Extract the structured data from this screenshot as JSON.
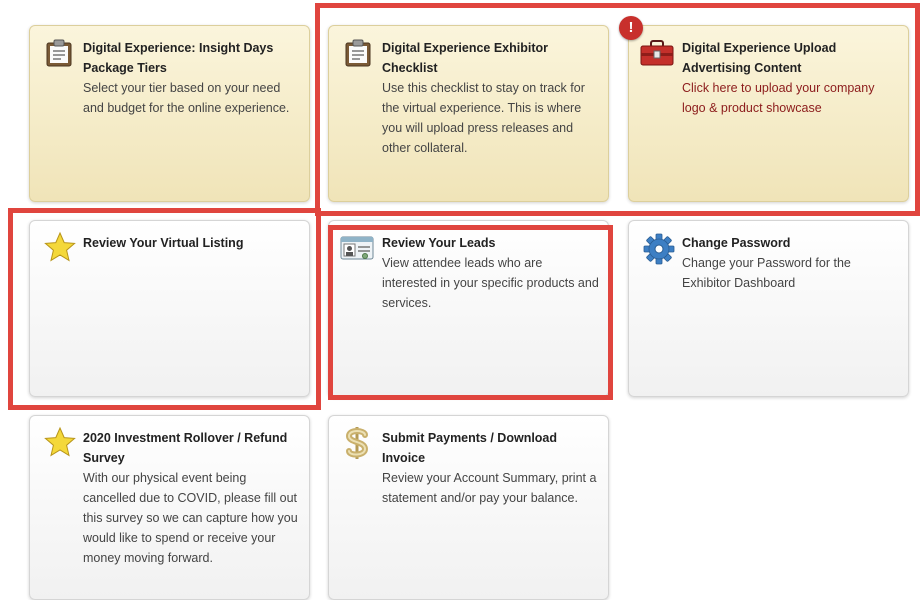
{
  "cards": [
    {
      "title": "Digital Experience: Insight Days Package Tiers",
      "desc": "Select your tier based on your need and budget for the online experience.",
      "icon": "clipboard-icon"
    },
    {
      "title": "Digital Experience Exhibitor Checklist",
      "desc": "Use this checklist to stay on track for the virtual experience. This is where you will upload press releases and other collateral.",
      "icon": "clipboard-icon"
    },
    {
      "title": "Digital Experience Upload Advertising Content",
      "desc": "Click here to upload your company logo & product showcase",
      "icon": "toolbox-icon",
      "badge": "!"
    },
    {
      "title": "Review Your Virtual Listing",
      "desc": "",
      "icon": "star-icon"
    },
    {
      "title": "Review Your Leads",
      "desc": "View attendee leads who are interested in your specific products and services.",
      "icon": "id-card-icon"
    },
    {
      "title": "Change Password",
      "desc": "Change your Password for the Exhibitor Dashboard",
      "icon": "gear-icon"
    },
    {
      "title": "2020 Investment Rollover / Refund Survey",
      "desc": "With our physical event being cancelled due to COVID, please fill out this survey so we can capture how you would like to spend or receive your money moving forward.",
      "icon": "star-icon"
    },
    {
      "title": "Submit Payments / Download Invoice",
      "desc": "Review your Account Summary, print a statement and/or pay your balance.",
      "icon": "dollar-icon"
    }
  ],
  "colors": {
    "highlight": "#e0453e",
    "alert_text": "#8c1c1c",
    "badge": "#c8302c"
  }
}
